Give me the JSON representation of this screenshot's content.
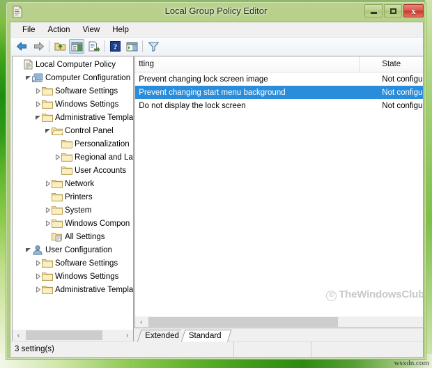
{
  "window": {
    "title": "Local Group Policy Editor",
    "icon": "policy-document-icon",
    "controls": {
      "minimize": "Minimize",
      "maximize": "Maximize",
      "close": "Close"
    }
  },
  "menubar": {
    "items": [
      {
        "label": "File"
      },
      {
        "label": "Action"
      },
      {
        "label": "View"
      },
      {
        "label": "Help"
      }
    ]
  },
  "toolbar": {
    "buttons": [
      {
        "name": "back-arrow-icon",
        "title": "Back"
      },
      {
        "name": "forward-arrow-icon",
        "title": "Forward"
      },
      {
        "name": "up-one-level-icon",
        "title": "Up One Level"
      },
      {
        "name": "show-hide-console-tree-icon",
        "title": "Show/Hide Console Tree"
      },
      {
        "name": "properties-icon",
        "title": "Properties"
      },
      {
        "name": "help-icon",
        "title": "Help"
      },
      {
        "name": "show-hide-action-pane-icon",
        "title": "Show/Hide Action Pane"
      },
      {
        "name": "filter-icon",
        "title": "Filter"
      }
    ]
  },
  "tree": {
    "nodes": [
      {
        "label": "Local Computer Policy",
        "indent": 0,
        "twist": "none",
        "icon": "policy-document-icon"
      },
      {
        "label": "Computer Configuration",
        "indent": 1,
        "twist": "expanded",
        "icon": "computer-icon"
      },
      {
        "label": "Software Settings",
        "indent": 2,
        "twist": "collapsed",
        "icon": "folder-icon"
      },
      {
        "label": "Windows Settings",
        "indent": 2,
        "twist": "collapsed",
        "icon": "folder-icon"
      },
      {
        "label": "Administrative Templa",
        "indent": 2,
        "twist": "expanded",
        "icon": "folder-icon"
      },
      {
        "label": "Control Panel",
        "indent": 3,
        "twist": "expanded",
        "icon": "folder-open-icon"
      },
      {
        "label": "Personalization",
        "indent": 4,
        "twist": "none",
        "icon": "folder-icon"
      },
      {
        "label": "Regional and La",
        "indent": 4,
        "twist": "collapsed",
        "icon": "folder-icon"
      },
      {
        "label": "User Accounts",
        "indent": 4,
        "twist": "none",
        "icon": "folder-icon"
      },
      {
        "label": "Network",
        "indent": 3,
        "twist": "collapsed",
        "icon": "folder-icon"
      },
      {
        "label": "Printers",
        "indent": 3,
        "twist": "none",
        "icon": "folder-icon"
      },
      {
        "label": "System",
        "indent": 3,
        "twist": "collapsed",
        "icon": "folder-icon"
      },
      {
        "label": "Windows Compon",
        "indent": 3,
        "twist": "collapsed",
        "icon": "folder-icon"
      },
      {
        "label": "All Settings",
        "indent": 3,
        "twist": "none",
        "icon": "all-settings-icon"
      },
      {
        "label": "User Configuration",
        "indent": 1,
        "twist": "expanded",
        "icon": "user-icon"
      },
      {
        "label": "Software Settings",
        "indent": 2,
        "twist": "collapsed",
        "icon": "folder-icon"
      },
      {
        "label": "Windows Settings",
        "indent": 2,
        "twist": "collapsed",
        "icon": "folder-icon"
      },
      {
        "label": "Administrative Templa",
        "indent": 2,
        "twist": "collapsed",
        "icon": "folder-icon"
      }
    ],
    "hscroll": {
      "left_arrow": "‹",
      "right_arrow": "›"
    }
  },
  "list": {
    "columns": [
      {
        "key": "setting",
        "label": "tting"
      },
      {
        "key": "state",
        "label": "State"
      }
    ],
    "rows": [
      {
        "setting": "Prevent changing lock screen image",
        "state": "Not configured",
        "selected": false
      },
      {
        "setting": "Prevent changing start menu background",
        "state": "Not configured",
        "selected": true
      },
      {
        "setting": "Do not display the lock screen",
        "state": "Not configured",
        "selected": false
      }
    ],
    "hscroll": {
      "left_arrow": "‹",
      "right_arrow": "›"
    },
    "selection_color": "#2a8ddb"
  },
  "tabs": [
    {
      "label": "Extended",
      "active": false
    },
    {
      "label": "Standard",
      "active": true
    }
  ],
  "statusbar": {
    "text": "3 setting(s)"
  },
  "watermarks": {
    "overlay": {
      "copyright": "©",
      "text": "TheWindowsClub"
    },
    "corner": "wsxdn.com"
  }
}
